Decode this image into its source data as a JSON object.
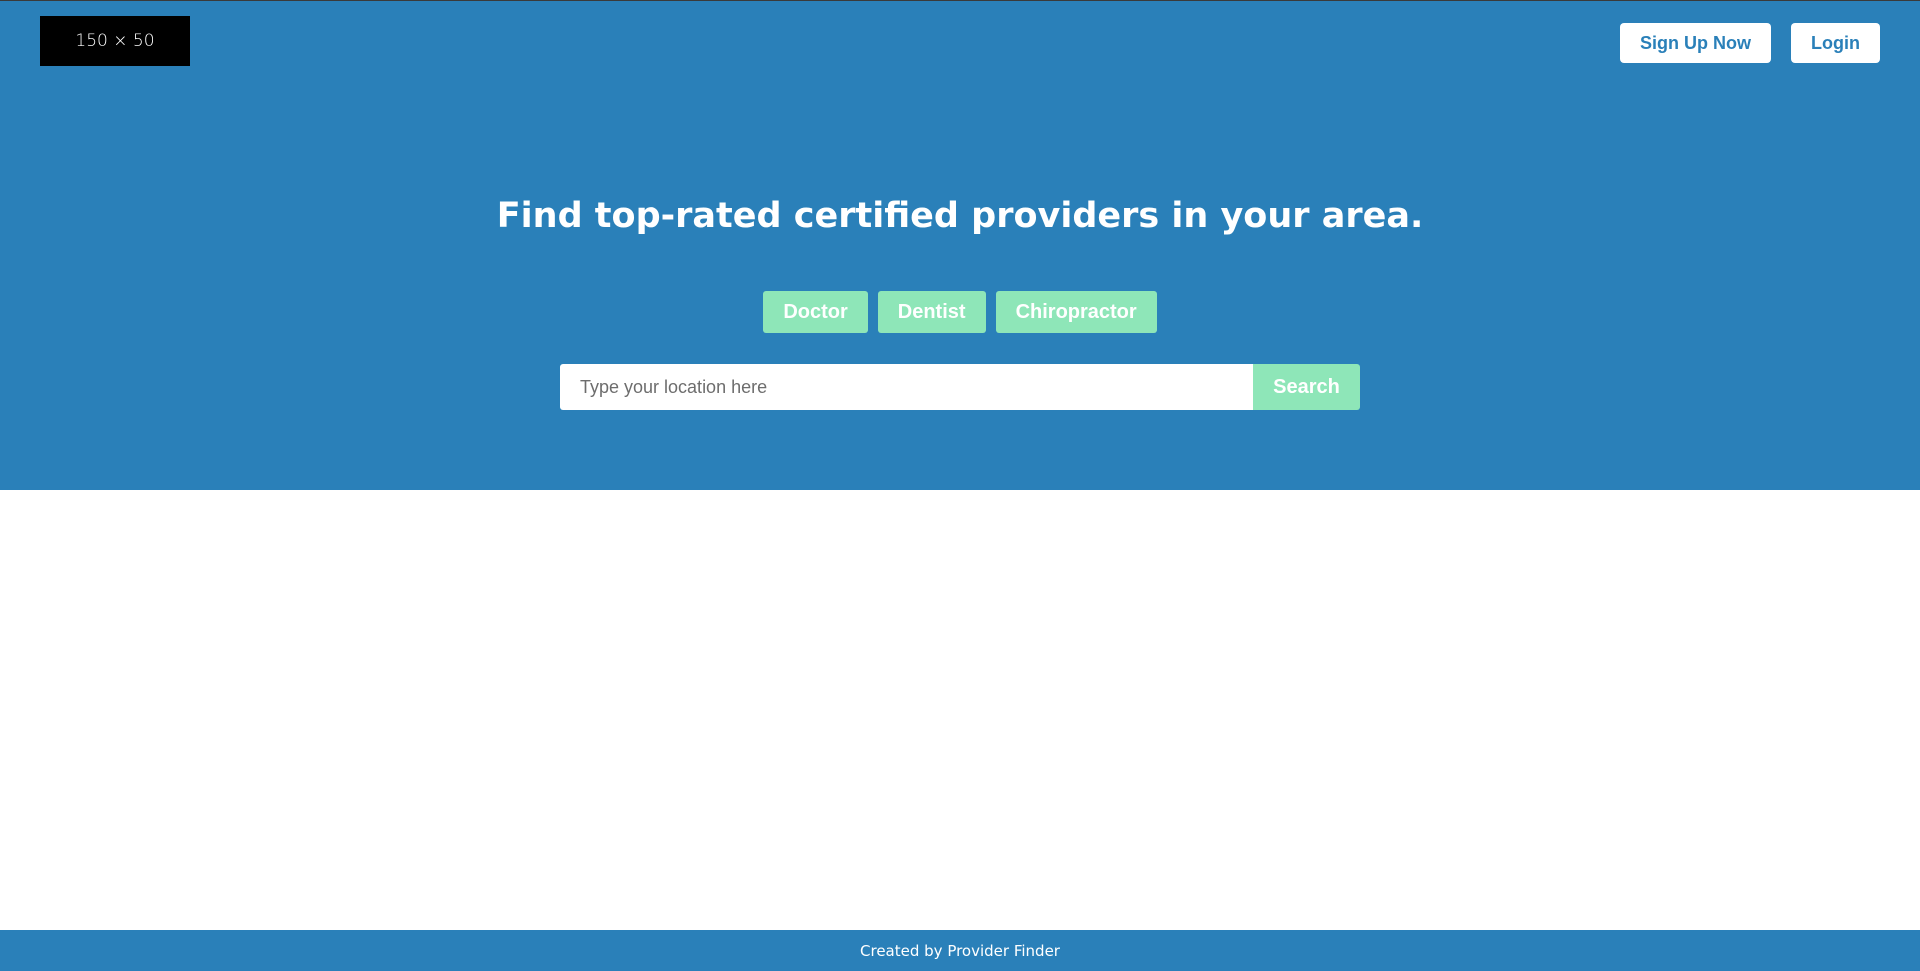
{
  "header": {
    "logo_text": "150 × 50",
    "signup_label": "Sign Up Now",
    "login_label": "Login"
  },
  "hero": {
    "headline": "Find top-rated certified providers in your area.",
    "categories": [
      {
        "label": "Doctor"
      },
      {
        "label": "Dentist"
      },
      {
        "label": "Chiropractor"
      }
    ],
    "search": {
      "placeholder": "Type your location here",
      "value": "",
      "button_label": "Search"
    }
  },
  "footer": {
    "text": "Created by Provider Finder"
  },
  "colors": {
    "primary": "#2a80b9",
    "accent": "#8ee6b8",
    "white": "#ffffff",
    "logo_bg": "#000000"
  }
}
